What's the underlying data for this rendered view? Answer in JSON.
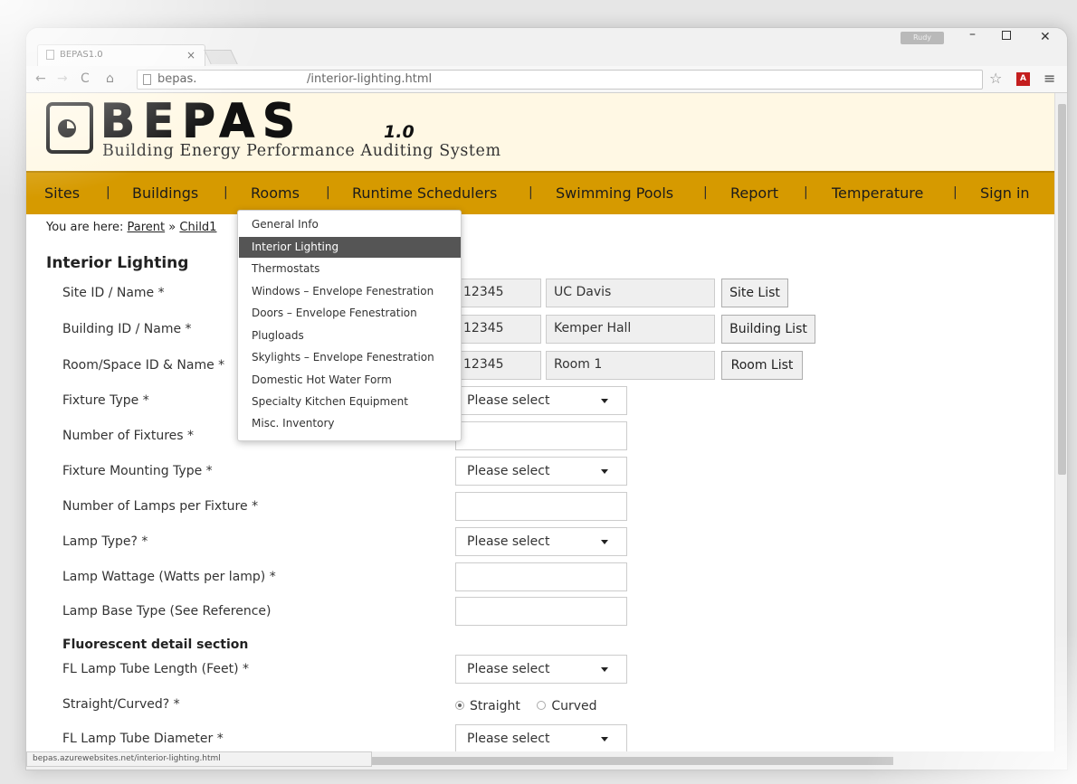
{
  "browser": {
    "tab_title": "BEPAS1.0",
    "tab_close": "×",
    "user_badge": "Rudy",
    "url_visible": "bepas.",
    "url_path": "/interior-lighting.html",
    "status_url": "bepas.azurewebsites.net/interior-lighting.html"
  },
  "header": {
    "logo_text": "BEPAS",
    "logo_version": "1.0",
    "subtitle": "Building Energy Performance Auditing System",
    "colors": {
      "banner": "#fff8e4",
      "nav": "#d69a00"
    }
  },
  "nav": {
    "items": [
      "Sites",
      "Buildings",
      "Rooms",
      "Runtime Schedulers",
      "Swimming Pools",
      "Report",
      "Temperature",
      "Sign in"
    ],
    "separator": "|"
  },
  "breadcrumb": {
    "prefix": "You are here:",
    "parent": "Parent",
    "sep": "»",
    "child": "Child1"
  },
  "rooms_menu": {
    "items": [
      "General Info",
      "Interior Lighting",
      "Thermostats",
      "Windows – Envelope Fenestration",
      "Doors – Envelope Fenestration",
      "Plugloads",
      "Skylights – Envelope Fenestration",
      "Domestic Hot Water Form",
      "Specialty Kitchen Equipment",
      "Misc. Inventory"
    ],
    "active": "Interior Lighting"
  },
  "form": {
    "heading": "Interior Lighting",
    "site": {
      "label": "Site ID / Name *",
      "id": "12345",
      "name": "UC Davis",
      "button": "Site List"
    },
    "building": {
      "label": "Building ID / Name *",
      "id": "12345",
      "name": "Kemper Hall",
      "button": "Building List"
    },
    "room": {
      "label": "Room/Space ID & Name *",
      "id": "12345",
      "name": "Room 1",
      "button": "Room List"
    },
    "fixture_type": {
      "label": "Fixture Type *",
      "value": "Please select"
    },
    "num_fixtures": {
      "label": "Number of Fixtures *"
    },
    "mounting_type": {
      "label": "Fixture Mounting Type *",
      "value": "Please select"
    },
    "lamps_per_fixture": {
      "label": "Number of Lamps per Fixture *"
    },
    "lamp_type": {
      "label": "Lamp Type? *",
      "value": "Please select"
    },
    "lamp_wattage": {
      "label": "Lamp Wattage (Watts per lamp) *"
    },
    "lamp_base": {
      "label": "Lamp Base Type (See Reference)"
    },
    "fluorescent_heading": "Fluorescent detail section",
    "tube_length": {
      "label": "FL Lamp Tube Length (Feet) *",
      "value": "Please select"
    },
    "straight_curved": {
      "label": "Straight/Curved? *",
      "option_a": "Straight",
      "option_b": "Curved",
      "selected": "Straight"
    },
    "tube_diameter": {
      "label": "FL Lamp Tube Diameter *",
      "value": "Please select"
    }
  }
}
